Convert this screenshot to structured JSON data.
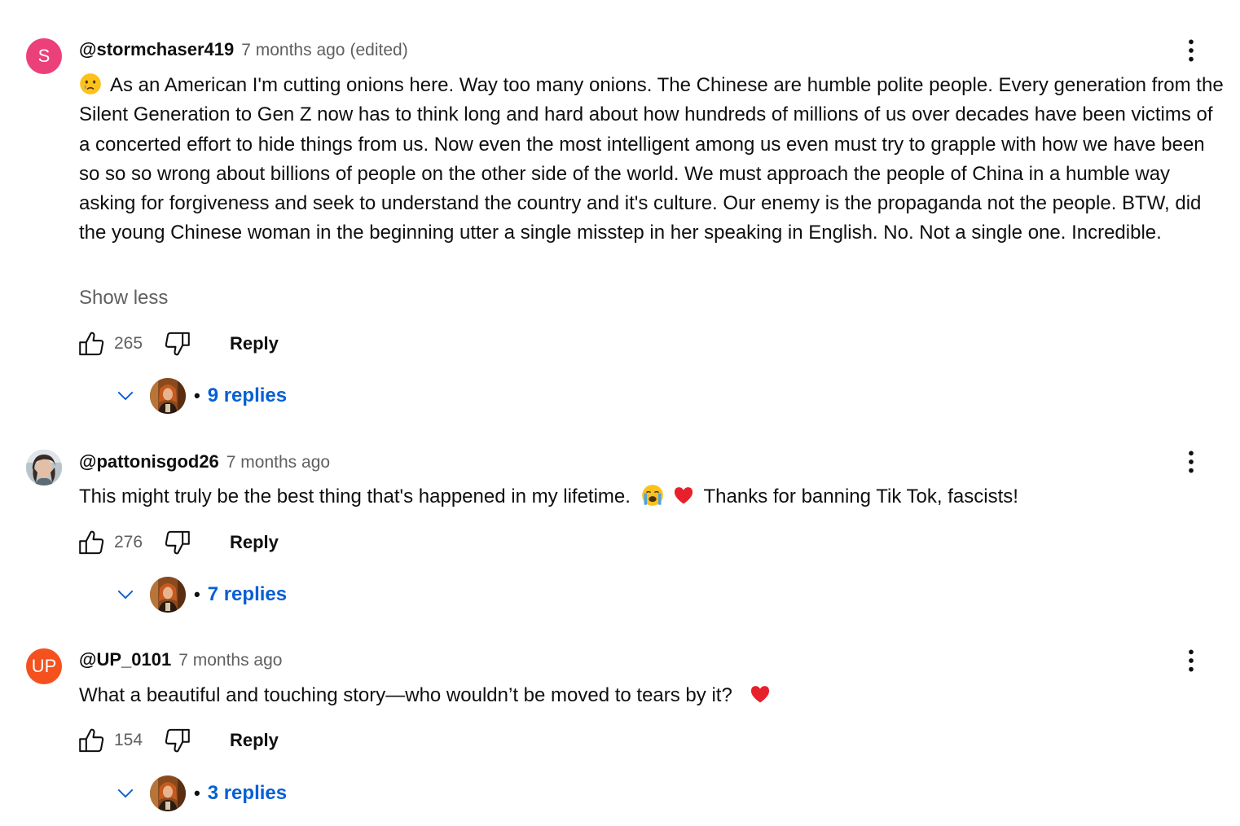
{
  "colors": {
    "link_blue": "#065fd4",
    "secondary_text": "#606060",
    "primary_text": "#0f0f0f",
    "avatar_pink": "#ec407a",
    "avatar_orange": "#f4511e"
  },
  "comments": [
    {
      "avatar_letter": "S",
      "avatar_color": "#ec407a",
      "author": "@stormchaser419",
      "time": "7 months ago",
      "edited": "(edited)",
      "leading_emoji_icon": "crying-face-icon",
      "text": "As an American I'm cutting onions here. Way too many onions. The Chinese are humble polite people.  Every generation from the Silent Generation to Gen Z now has to think long and hard about how hundreds of millions of us over decades have been victims of a concerted effort to hide things from us. Now even the most intelligent among us even must try to grapple with how we have been so so so wrong about billions of people on the other side of the world. We must approach the people of China in a humble way asking for forgiveness and seek to understand the country and it's culture. Our enemy is the propaganda not the people. BTW, did the young Chinese woman in the beginning utter a single misstep in her speaking in English. No. Not a single one. Incredible.",
      "show_less": "Show less",
      "likes": "265",
      "reply_label": "Reply",
      "replies": "9 replies"
    },
    {
      "avatar_icon": "user-photo-avatar",
      "author": "@pattonisgod26",
      "time": "7 months ago",
      "text_before": "This might truly be the best thing that's happened in my lifetime.",
      "emoji_icons": [
        "loudly-crying-face-icon",
        "red-heart-icon"
      ],
      "text_after": "Thanks for banning Tik Tok, fascists!",
      "likes": "276",
      "reply_label": "Reply",
      "replies": "7 replies"
    },
    {
      "avatar_letter": "UP",
      "avatar_color": "#f4511e",
      "author": "@UP_0101",
      "time": "7 months ago",
      "text": "What a beautiful and touching story—who wouldn’t be moved to tears by it?",
      "trailing_emoji_icon": "red-heart-icon",
      "likes": "154",
      "reply_label": "Reply",
      "replies": "3 replies"
    }
  ],
  "creator_avatar_icon": "creator-avatar"
}
